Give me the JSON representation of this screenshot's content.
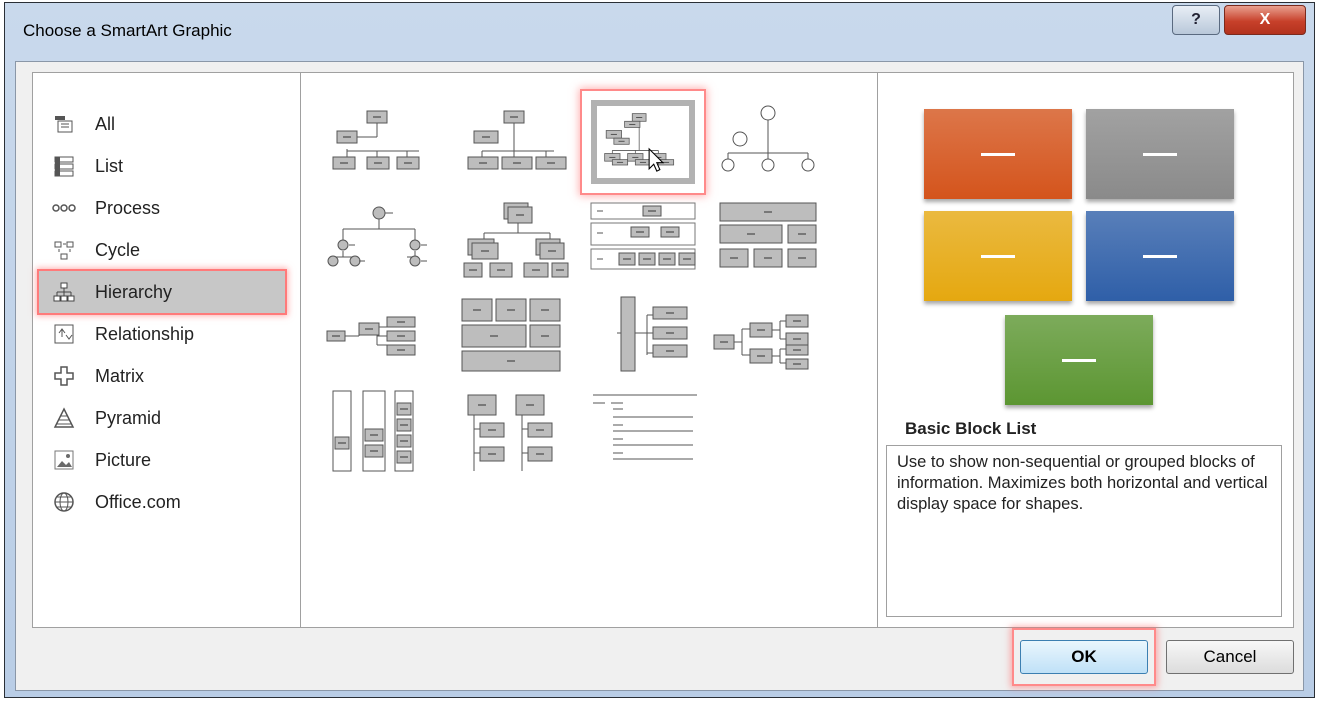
{
  "window": {
    "title": "Choose a SmartArt Graphic",
    "help_label": "?",
    "close_label": "X"
  },
  "categories": [
    {
      "label": "All",
      "icon": "all-icon"
    },
    {
      "label": "List",
      "icon": "list-icon"
    },
    {
      "label": "Process",
      "icon": "process-icon"
    },
    {
      "label": "Cycle",
      "icon": "cycle-icon"
    },
    {
      "label": "Hierarchy",
      "icon": "hierarchy-icon",
      "selected": true
    },
    {
      "label": "Relationship",
      "icon": "relationship-icon"
    },
    {
      "label": "Matrix",
      "icon": "matrix-icon"
    },
    {
      "label": "Pyramid",
      "icon": "pyramid-icon"
    },
    {
      "label": "Picture",
      "icon": "picture-icon"
    },
    {
      "label": "Office.com",
      "icon": "globe-icon"
    }
  ],
  "layouts": [
    {
      "icon": "organization-chart-icon"
    },
    {
      "icon": "picture-organization-chart-icon"
    },
    {
      "icon": "name-and-title-organization-chart-icon",
      "selected": true
    },
    {
      "icon": "circle-picture-hierarchy-icon"
    },
    {
      "icon": "hierarchy-icon"
    },
    {
      "icon": "labeled-hierarchy-icon"
    },
    {
      "icon": "table-hierarchy-icon"
    },
    {
      "icon": "architecture-layout-icon"
    },
    {
      "icon": "horizontal-hierarchy-icon"
    },
    {
      "icon": "stacked-blocks-icon"
    },
    {
      "icon": "vertical-bracket-hierarchy-icon"
    },
    {
      "icon": "horizontal-labeled-hierarchy-icon"
    },
    {
      "icon": "lined-list-hierarchy-icon"
    },
    {
      "icon": "vertical-box-list-icon"
    },
    {
      "icon": "lined-list-icon"
    }
  ],
  "preview": {
    "colors": [
      "#d4541c",
      "#8a8a8a",
      "#e5a810",
      "#2f5fa8",
      "#5c9632"
    ],
    "title": "Basic Block List",
    "description": "Use to show non-sequential or grouped blocks of information. Maximizes both horizontal and vertical display space for shapes."
  },
  "buttons": {
    "ok_label": "OK",
    "cancel_label": "Cancel"
  }
}
